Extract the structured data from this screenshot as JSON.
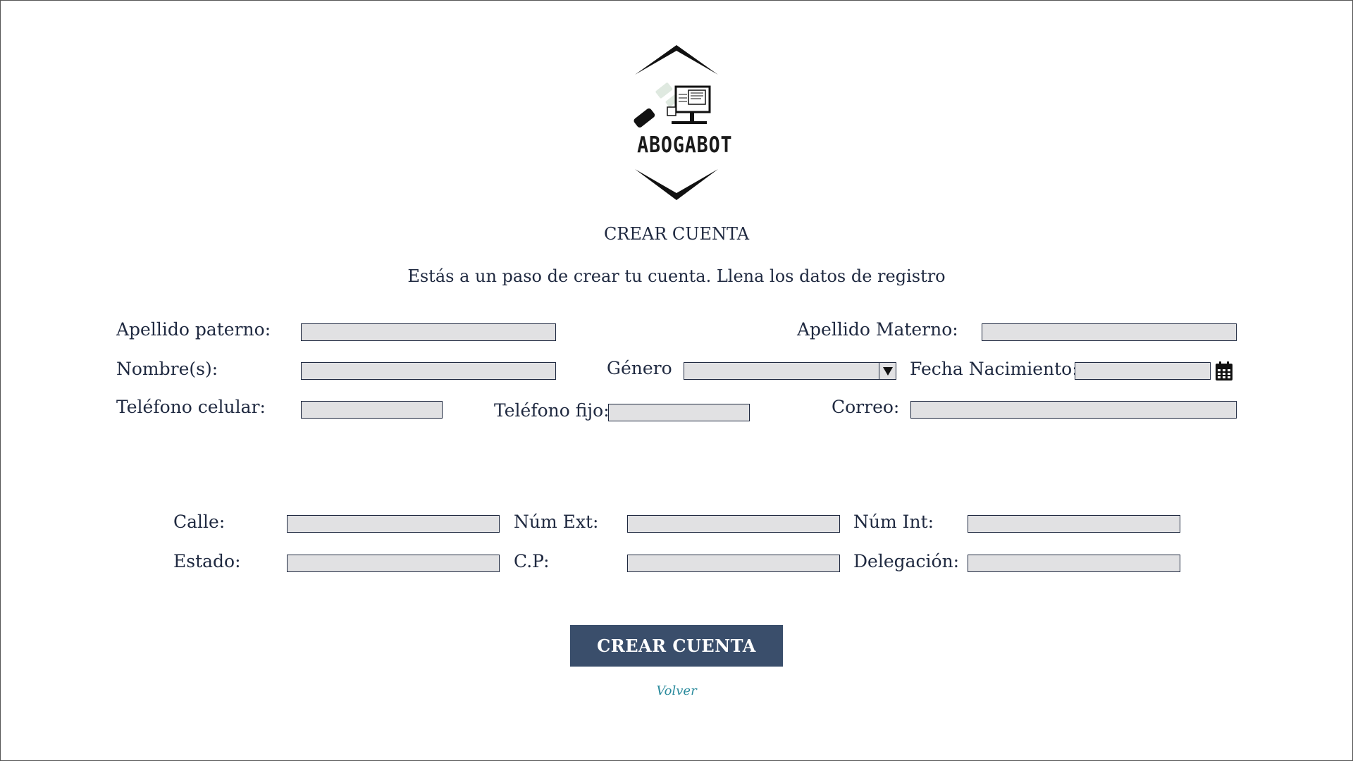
{
  "logo": {
    "text": "ABOGABOT"
  },
  "header": {
    "title": "CREAR CUENTA",
    "subtitle": "Estás a un paso de crear tu cuenta. Llena los datos de registro"
  },
  "personal": {
    "apellido_paterno": {
      "label": "Apellido paterno:",
      "value": ""
    },
    "apellido_materno": {
      "label": "Apellido Materno:",
      "value": ""
    },
    "nombres": {
      "label": "Nombre(s):",
      "value": ""
    },
    "genero": {
      "label": "Género",
      "selected": ""
    },
    "fecha_nacimiento": {
      "label": "Fecha Nacimiento:",
      "value": ""
    },
    "telefono_celular": {
      "label": "Teléfono celular:",
      "value": ""
    },
    "telefono_fijo": {
      "label": "Teléfono fijo:",
      "value": ""
    },
    "correo": {
      "label": "Correo:",
      "value": ""
    }
  },
  "address": {
    "calle": {
      "label": "Calle:",
      "value": ""
    },
    "num_ext": {
      "label": "Núm Ext:",
      "value": ""
    },
    "num_int": {
      "label": "Núm Int:",
      "value": ""
    },
    "estado": {
      "label": "Estado:",
      "value": ""
    },
    "cp": {
      "label": "C.P:",
      "value": ""
    },
    "delegacion": {
      "label": "Delegación:",
      "value": ""
    }
  },
  "actions": {
    "submit_label": "CREAR CUENTA",
    "back_label": "Volver"
  },
  "icons": {
    "dropdown": "triangle-down-icon",
    "calendar": "calendar-icon"
  },
  "colors": {
    "button_bg": "#3a4e6b",
    "input_bg": "#e1e1e3",
    "text": "#1f2940",
    "link": "#2b8b9d"
  }
}
